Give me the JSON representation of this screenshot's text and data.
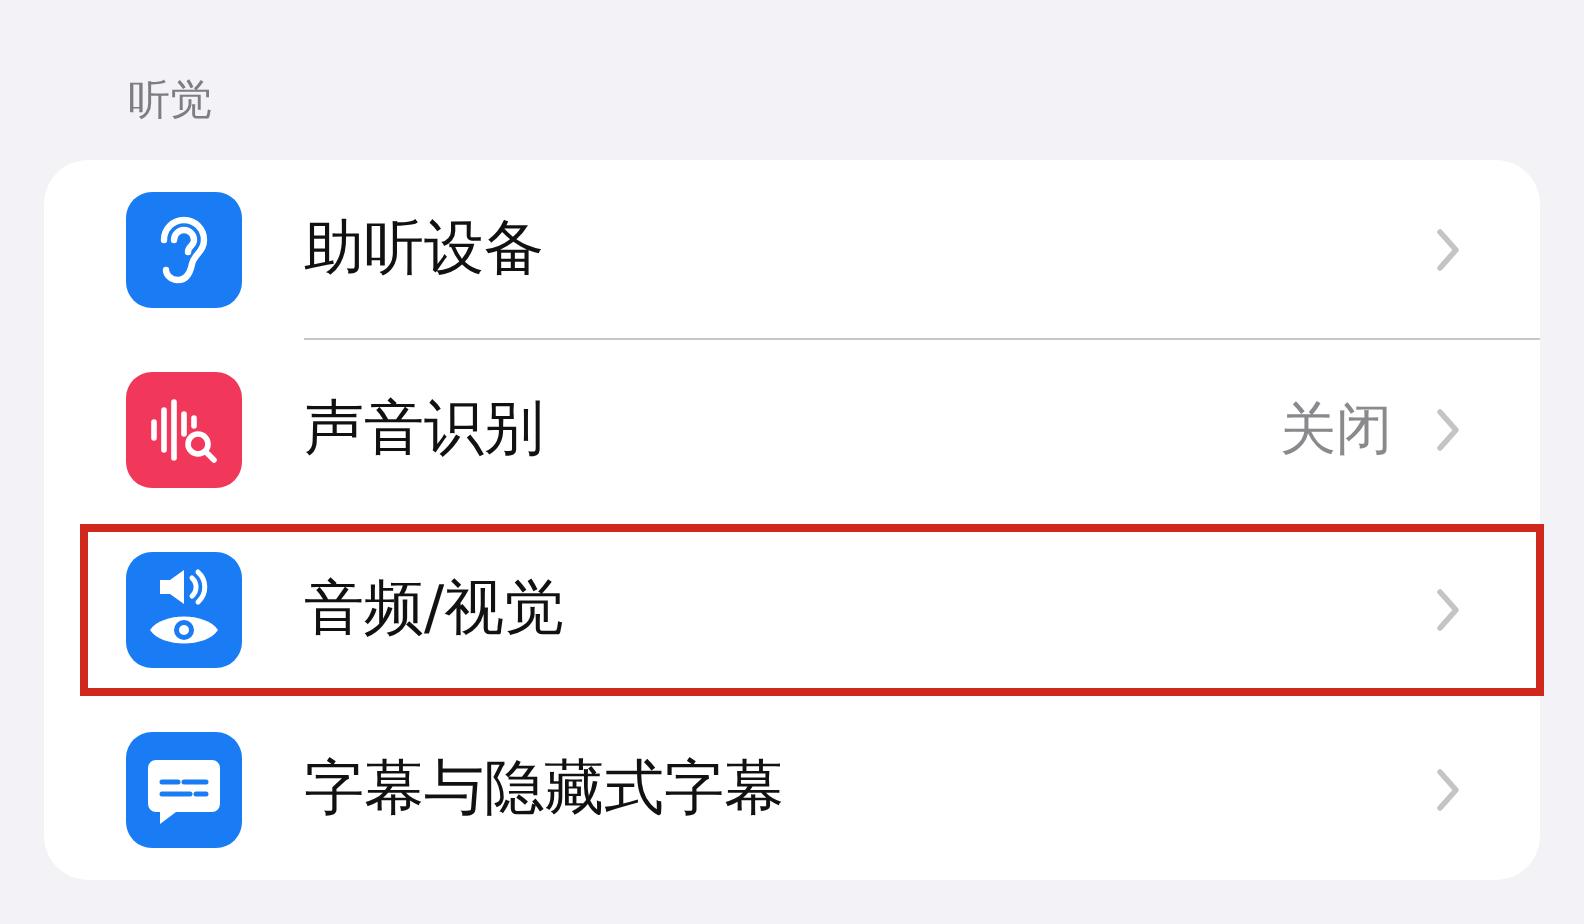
{
  "section": {
    "title": "听觉"
  },
  "rows": [
    {
      "kind": "ear",
      "color": "#1a7cf5",
      "label": "助听设备",
      "divider": true,
      "highlighted": false
    },
    {
      "kind": "sound",
      "color": "#f2385a",
      "label": "声音识别",
      "value": "关闭",
      "divider": false,
      "highlighted": false
    },
    {
      "kind": "audio-visual",
      "color": "#1a7cf5",
      "label": "音频/视觉",
      "divider": false,
      "highlighted": true
    },
    {
      "kind": "captions",
      "color": "#1a7cf5",
      "label": "字幕与隐藏式字幕",
      "divider": false,
      "highlighted": false
    }
  ]
}
